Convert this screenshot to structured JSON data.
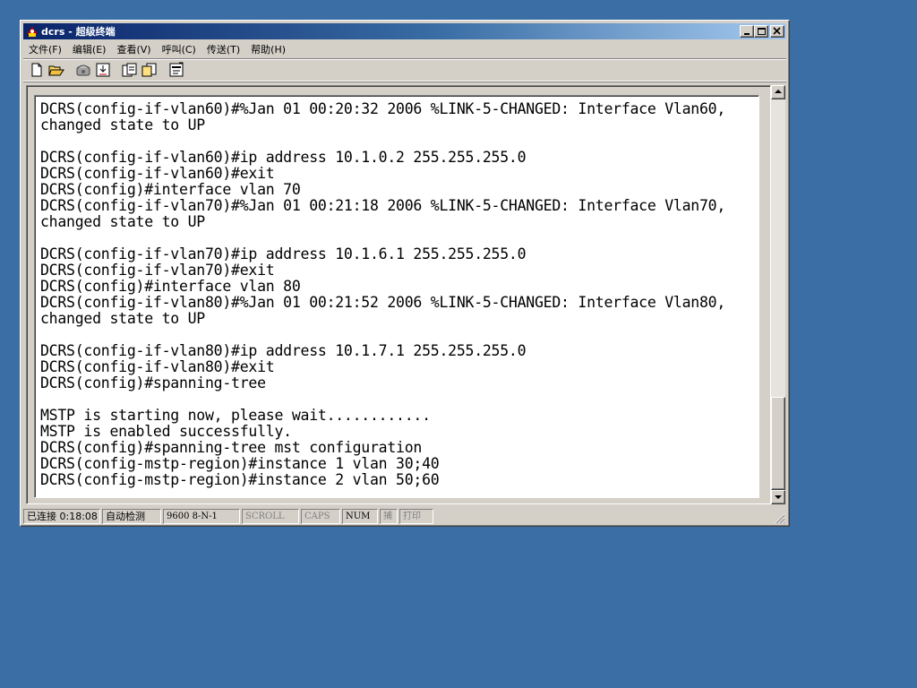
{
  "window": {
    "title": "dcrs - 超级终端"
  },
  "menu": [
    "文件(F)",
    "编辑(E)",
    "查看(V)",
    "呼叫(C)",
    "传送(T)",
    "帮助(H)"
  ],
  "toolbar": {
    "icons": [
      "new-icon",
      "open-icon",
      "disconnect-icon",
      "properties-dial-icon",
      "send-icon",
      "receive-icon",
      "properties-icon"
    ]
  },
  "terminal": {
    "lines": [
      "DCRS(config-if-vlan60)#%Jan 01 00:20:32 2006 %LINK-5-CHANGED: Interface Vlan60,",
      "changed state to UP",
      "",
      "DCRS(config-if-vlan60)#ip address 10.1.0.2 255.255.255.0",
      "DCRS(config-if-vlan60)#exit",
      "DCRS(config)#interface vlan 70",
      "DCRS(config-if-vlan70)#%Jan 01 00:21:18 2006 %LINK-5-CHANGED: Interface Vlan70,",
      "changed state to UP",
      "",
      "DCRS(config-if-vlan70)#ip address 10.1.6.1 255.255.255.0",
      "DCRS(config-if-vlan70)#exit",
      "DCRS(config)#interface vlan 80",
      "DCRS(config-if-vlan80)#%Jan 01 00:21:52 2006 %LINK-5-CHANGED: Interface Vlan80,",
      "changed state to UP",
      "",
      "DCRS(config-if-vlan80)#ip address 10.1.7.1 255.255.255.0",
      "DCRS(config-if-vlan80)#exit",
      "DCRS(config)#spanning-tree",
      "",
      "MSTP is starting now, please wait............",
      "MSTP is enabled successfully.",
      "DCRS(config)#spanning-tree mst configuration",
      "DCRS(config-mstp-region)#instance 1 vlan 30;40",
      "DCRS(config-mstp-region)#instance 2 vlan 50;60"
    ]
  },
  "status": {
    "connected": "已连接 0:18:08",
    "detect": "自动检测",
    "params": "9600 8-N-1",
    "scroll": "SCROLL",
    "caps": "CAPS",
    "num": "NUM",
    "capture": "捕",
    "print": "打印"
  }
}
